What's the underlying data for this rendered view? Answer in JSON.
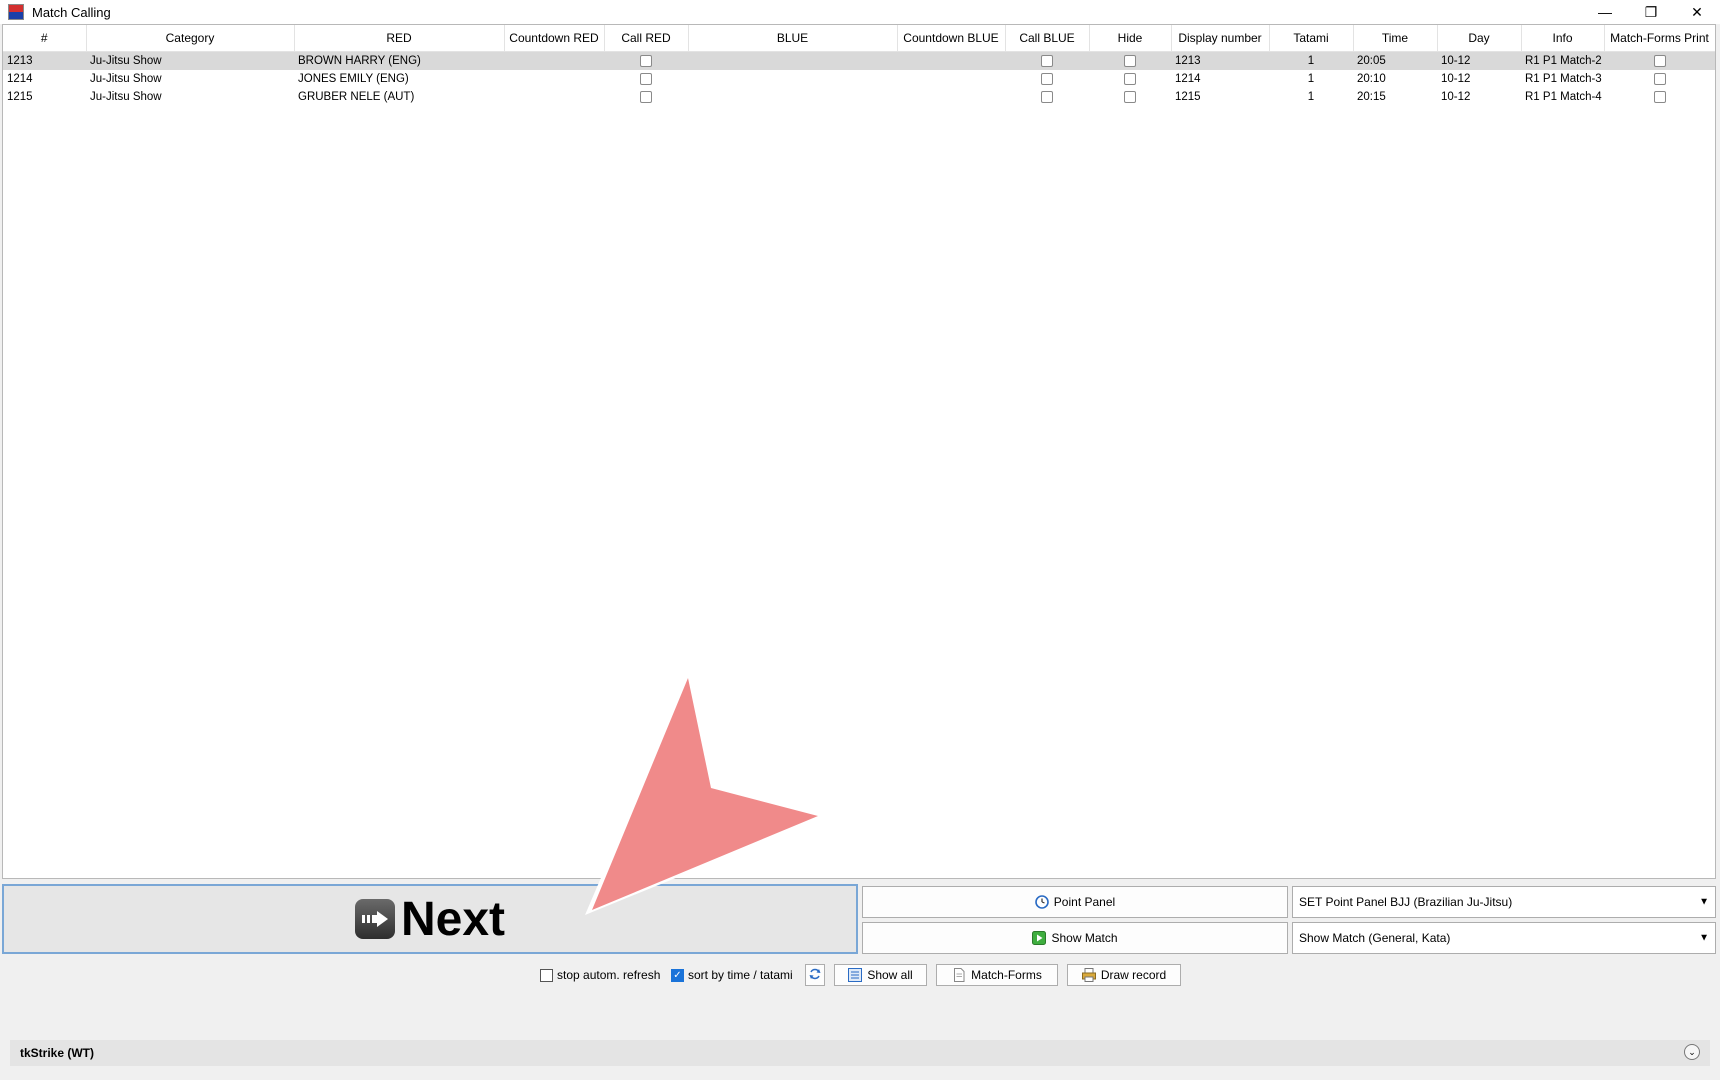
{
  "window": {
    "title": "Match Calling",
    "minimize": "—",
    "restore": "❐",
    "close": "✕"
  },
  "table": {
    "columns": [
      "#",
      "Category",
      "RED",
      "Countdown RED",
      "Call RED",
      "BLUE",
      "Countdown BLUE",
      "Call BLUE",
      "Hide",
      "Display number",
      "Tatami",
      "Time",
      "Day",
      "Info",
      "Match-Forms Print"
    ],
    "rows": [
      {
        "num": "1213",
        "category": "Ju-Jitsu Show",
        "red": "BROWN HARRY  (ENG)",
        "blue": "",
        "display": "1213",
        "tatami": "1",
        "time": "20:05",
        "day": "10-12",
        "info": "R1 P1 Match-2",
        "selected": true
      },
      {
        "num": "1214",
        "category": "Ju-Jitsu Show",
        "red": "JONES EMILY  (ENG)",
        "blue": "",
        "display": "1214",
        "tatami": "1",
        "time": "20:10",
        "day": "10-12",
        "info": "R1 P1 Match-3",
        "selected": false
      },
      {
        "num": "1215",
        "category": "Ju-Jitsu Show",
        "red": "GRUBER NELE  (AUT)",
        "blue": "",
        "display": "1215",
        "tatami": "1",
        "time": "20:15",
        "day": "10-12",
        "info": "R1 P1 Match-4",
        "selected": false
      }
    ]
  },
  "controls": {
    "next_label": "Next",
    "point_panel_label": "Point Panel",
    "show_match_label": "Show Match",
    "point_panel_select": "SET Point Panel BJJ (Brazilian Ju-Jitsu)",
    "show_match_select": "Show Match (General, Kata)",
    "stop_refresh_label": "stop autom. refresh",
    "sort_label": "sort by time / tatami",
    "show_all_label": "Show all",
    "match_forms_label": "Match-Forms",
    "draw_record_label": "Draw record",
    "sort_checked": true,
    "stop_refresh_checked": false
  },
  "status": {
    "label": "tkStrike (WT)"
  },
  "colors": {
    "accent": "#7aa7d6",
    "cursor": "#f08080",
    "selected_row": "#d9d9d9"
  }
}
